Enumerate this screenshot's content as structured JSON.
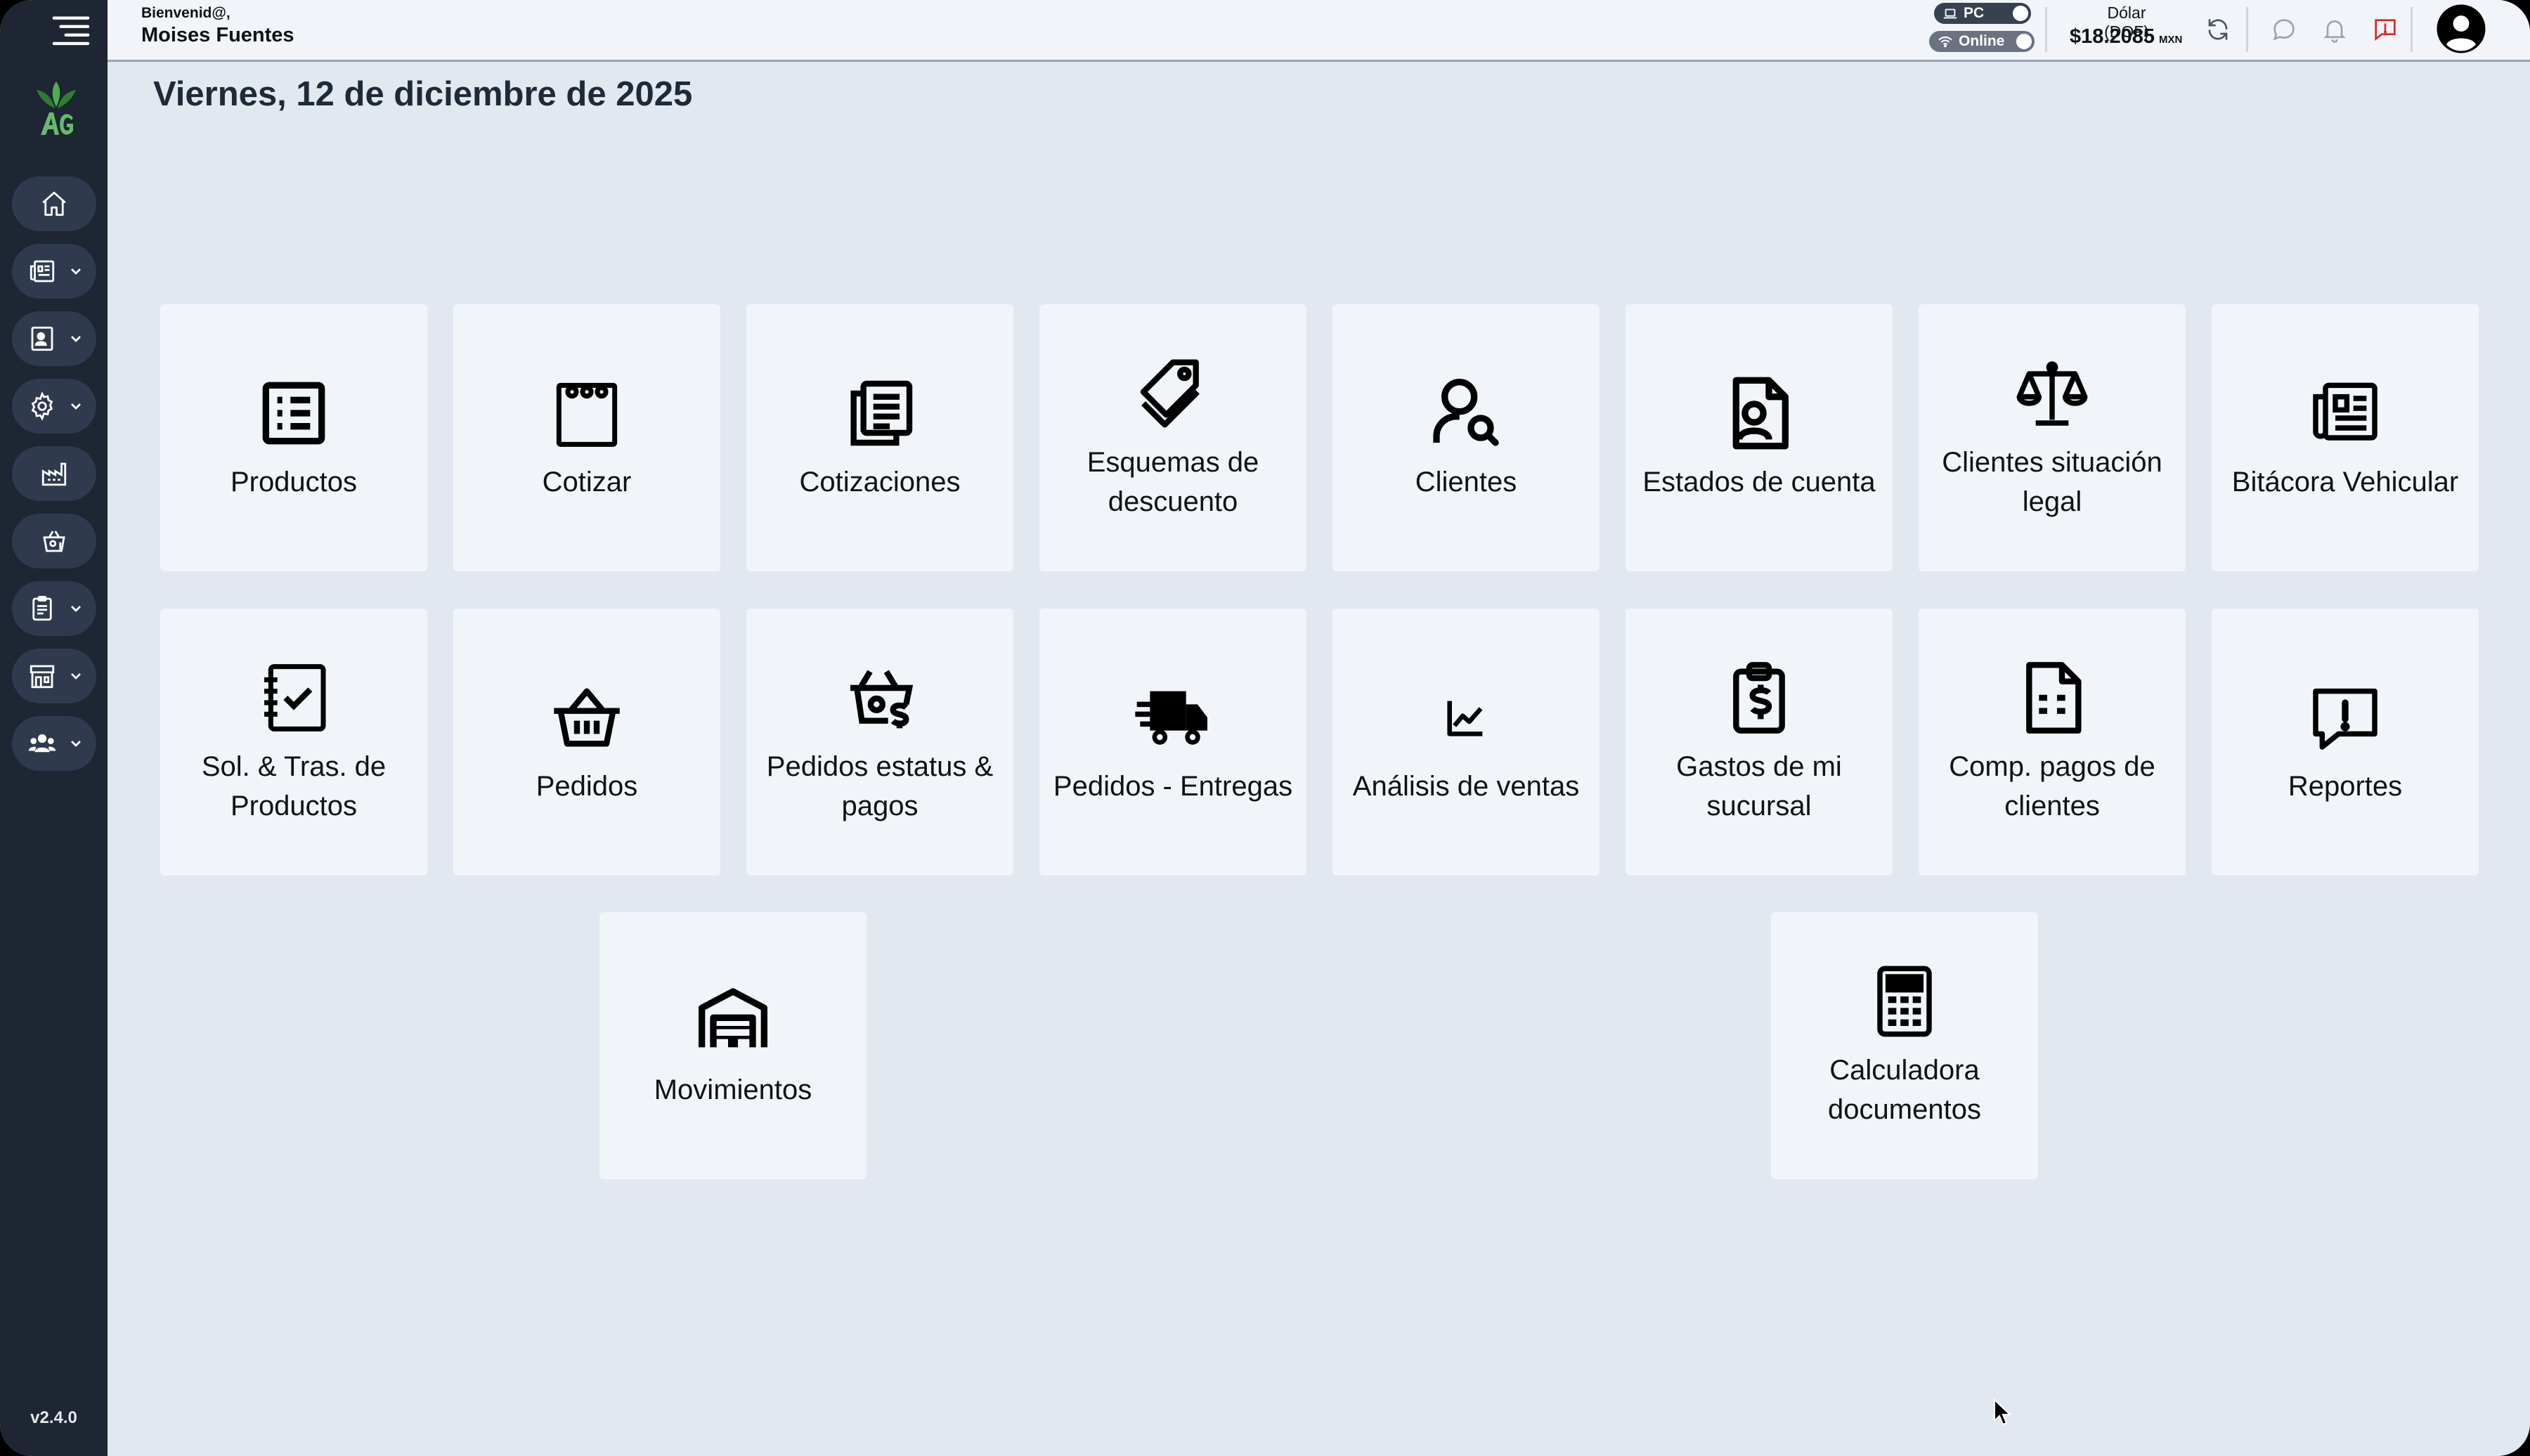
{
  "header": {
    "welcome": "Bienvenid@,",
    "user_name": "Moises Fuentes",
    "pc_label": "PC",
    "online_label": "Online",
    "dolar_label": "Dólar (DOF)",
    "dolar_value": "$18.2085",
    "dolar_currency": "MXN"
  },
  "sidebar": {
    "items": [
      {
        "icon": "home-icon"
      },
      {
        "icon": "newspaper-icon"
      },
      {
        "icon": "contact-card-icon"
      },
      {
        "icon": "gear-icon"
      },
      {
        "icon": "factory-icon"
      },
      {
        "icon": "basket-money-icon"
      },
      {
        "icon": "clipboard-icon"
      },
      {
        "icon": "store-icon"
      },
      {
        "icon": "users-icon"
      }
    ],
    "version": "v2.4.0"
  },
  "main": {
    "date": "Viernes, 12 de diciembre de 2025",
    "tiles": [
      {
        "label": "Productos",
        "icon": "list-icon"
      },
      {
        "label": "Cotizar",
        "icon": "notepad-icon"
      },
      {
        "label": "Cotizaciones",
        "icon": "documents-icon"
      },
      {
        "label": "Esquemas de descuento",
        "icon": "tags-icon"
      },
      {
        "label": "Clientes",
        "icon": "user-search-icon"
      },
      {
        "label": "Estados de cuenta",
        "icon": "contact-document-icon"
      },
      {
        "label": "Clientes situación legal",
        "icon": "scale-icon"
      },
      {
        "label": "Bitácora Vehicular",
        "icon": "newspaper-icon"
      },
      {
        "label": "Sol. & Tras. de Productos",
        "icon": "checklist-notebook-icon"
      },
      {
        "label": "Pedidos",
        "icon": "basket-icon"
      },
      {
        "label": "Pedidos estatus & pagos",
        "icon": "basket-money-icon"
      },
      {
        "label": "Pedidos - Entregas",
        "icon": "truck-fast-icon"
      },
      {
        "label": "Análisis de ventas",
        "icon": "chart-line-icon"
      },
      {
        "label": "Gastos de mi sucursal",
        "icon": "clipboard-dollar-icon"
      },
      {
        "label": "Comp. pagos de clientes",
        "icon": "invoice-icon"
      },
      {
        "label": "Reportes",
        "icon": "alert-message-icon"
      },
      {
        "label": "Movimientos",
        "icon": "warehouse-icon"
      },
      {
        "label": "Calculadora documentos",
        "icon": "calculator-icon"
      }
    ]
  }
}
